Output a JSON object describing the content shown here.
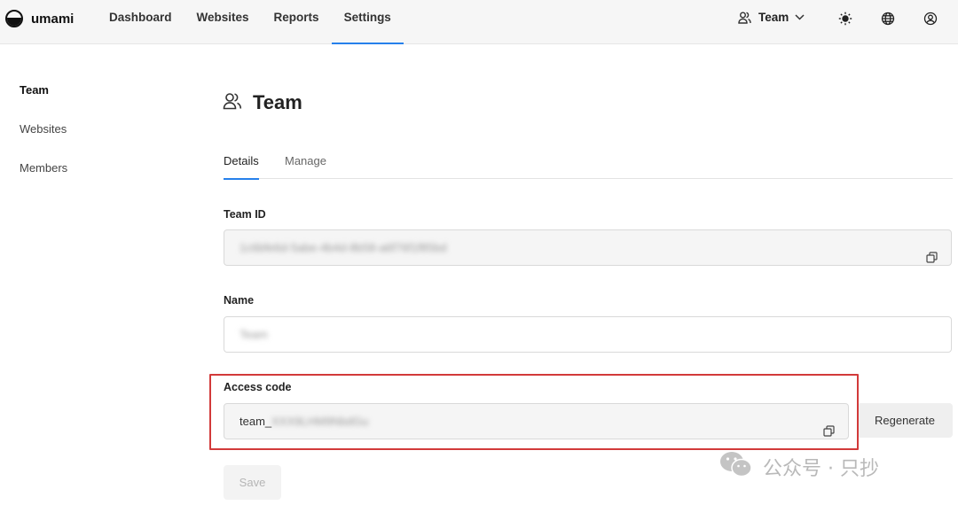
{
  "app": {
    "name": "umami"
  },
  "nav": {
    "items": [
      {
        "label": "Dashboard"
      },
      {
        "label": "Websites"
      },
      {
        "label": "Reports"
      },
      {
        "label": "Settings"
      }
    ],
    "active": "Settings"
  },
  "header": {
    "team_label": "Team",
    "icons": [
      "sun-icon",
      "globe-icon",
      "user-circle-icon"
    ]
  },
  "sidebar": {
    "items": [
      {
        "label": "Team"
      },
      {
        "label": "Websites"
      },
      {
        "label": "Members"
      }
    ],
    "active": "Team"
  },
  "main": {
    "title": "Team",
    "tabs": [
      {
        "label": "Details"
      },
      {
        "label": "Manage"
      }
    ],
    "active_tab": "Details",
    "team_id": {
      "label": "Team ID",
      "value": "1c6bfe6d-5abe-4b4d-8b58-a6f76f1f85bd"
    },
    "name": {
      "label": "Name",
      "value": "Team"
    },
    "access_code": {
      "label": "Access code",
      "prefix": "team_",
      "value": "XXX9LHM9NbdGu"
    },
    "regenerate_label": "Regenerate",
    "save_label": "Save"
  },
  "watermark": {
    "text": "公众号 · 只抄"
  },
  "colors": {
    "accent": "#2680eb",
    "highlight_border": "#d23a3a",
    "topbar_bg": "#f6f6f6"
  }
}
